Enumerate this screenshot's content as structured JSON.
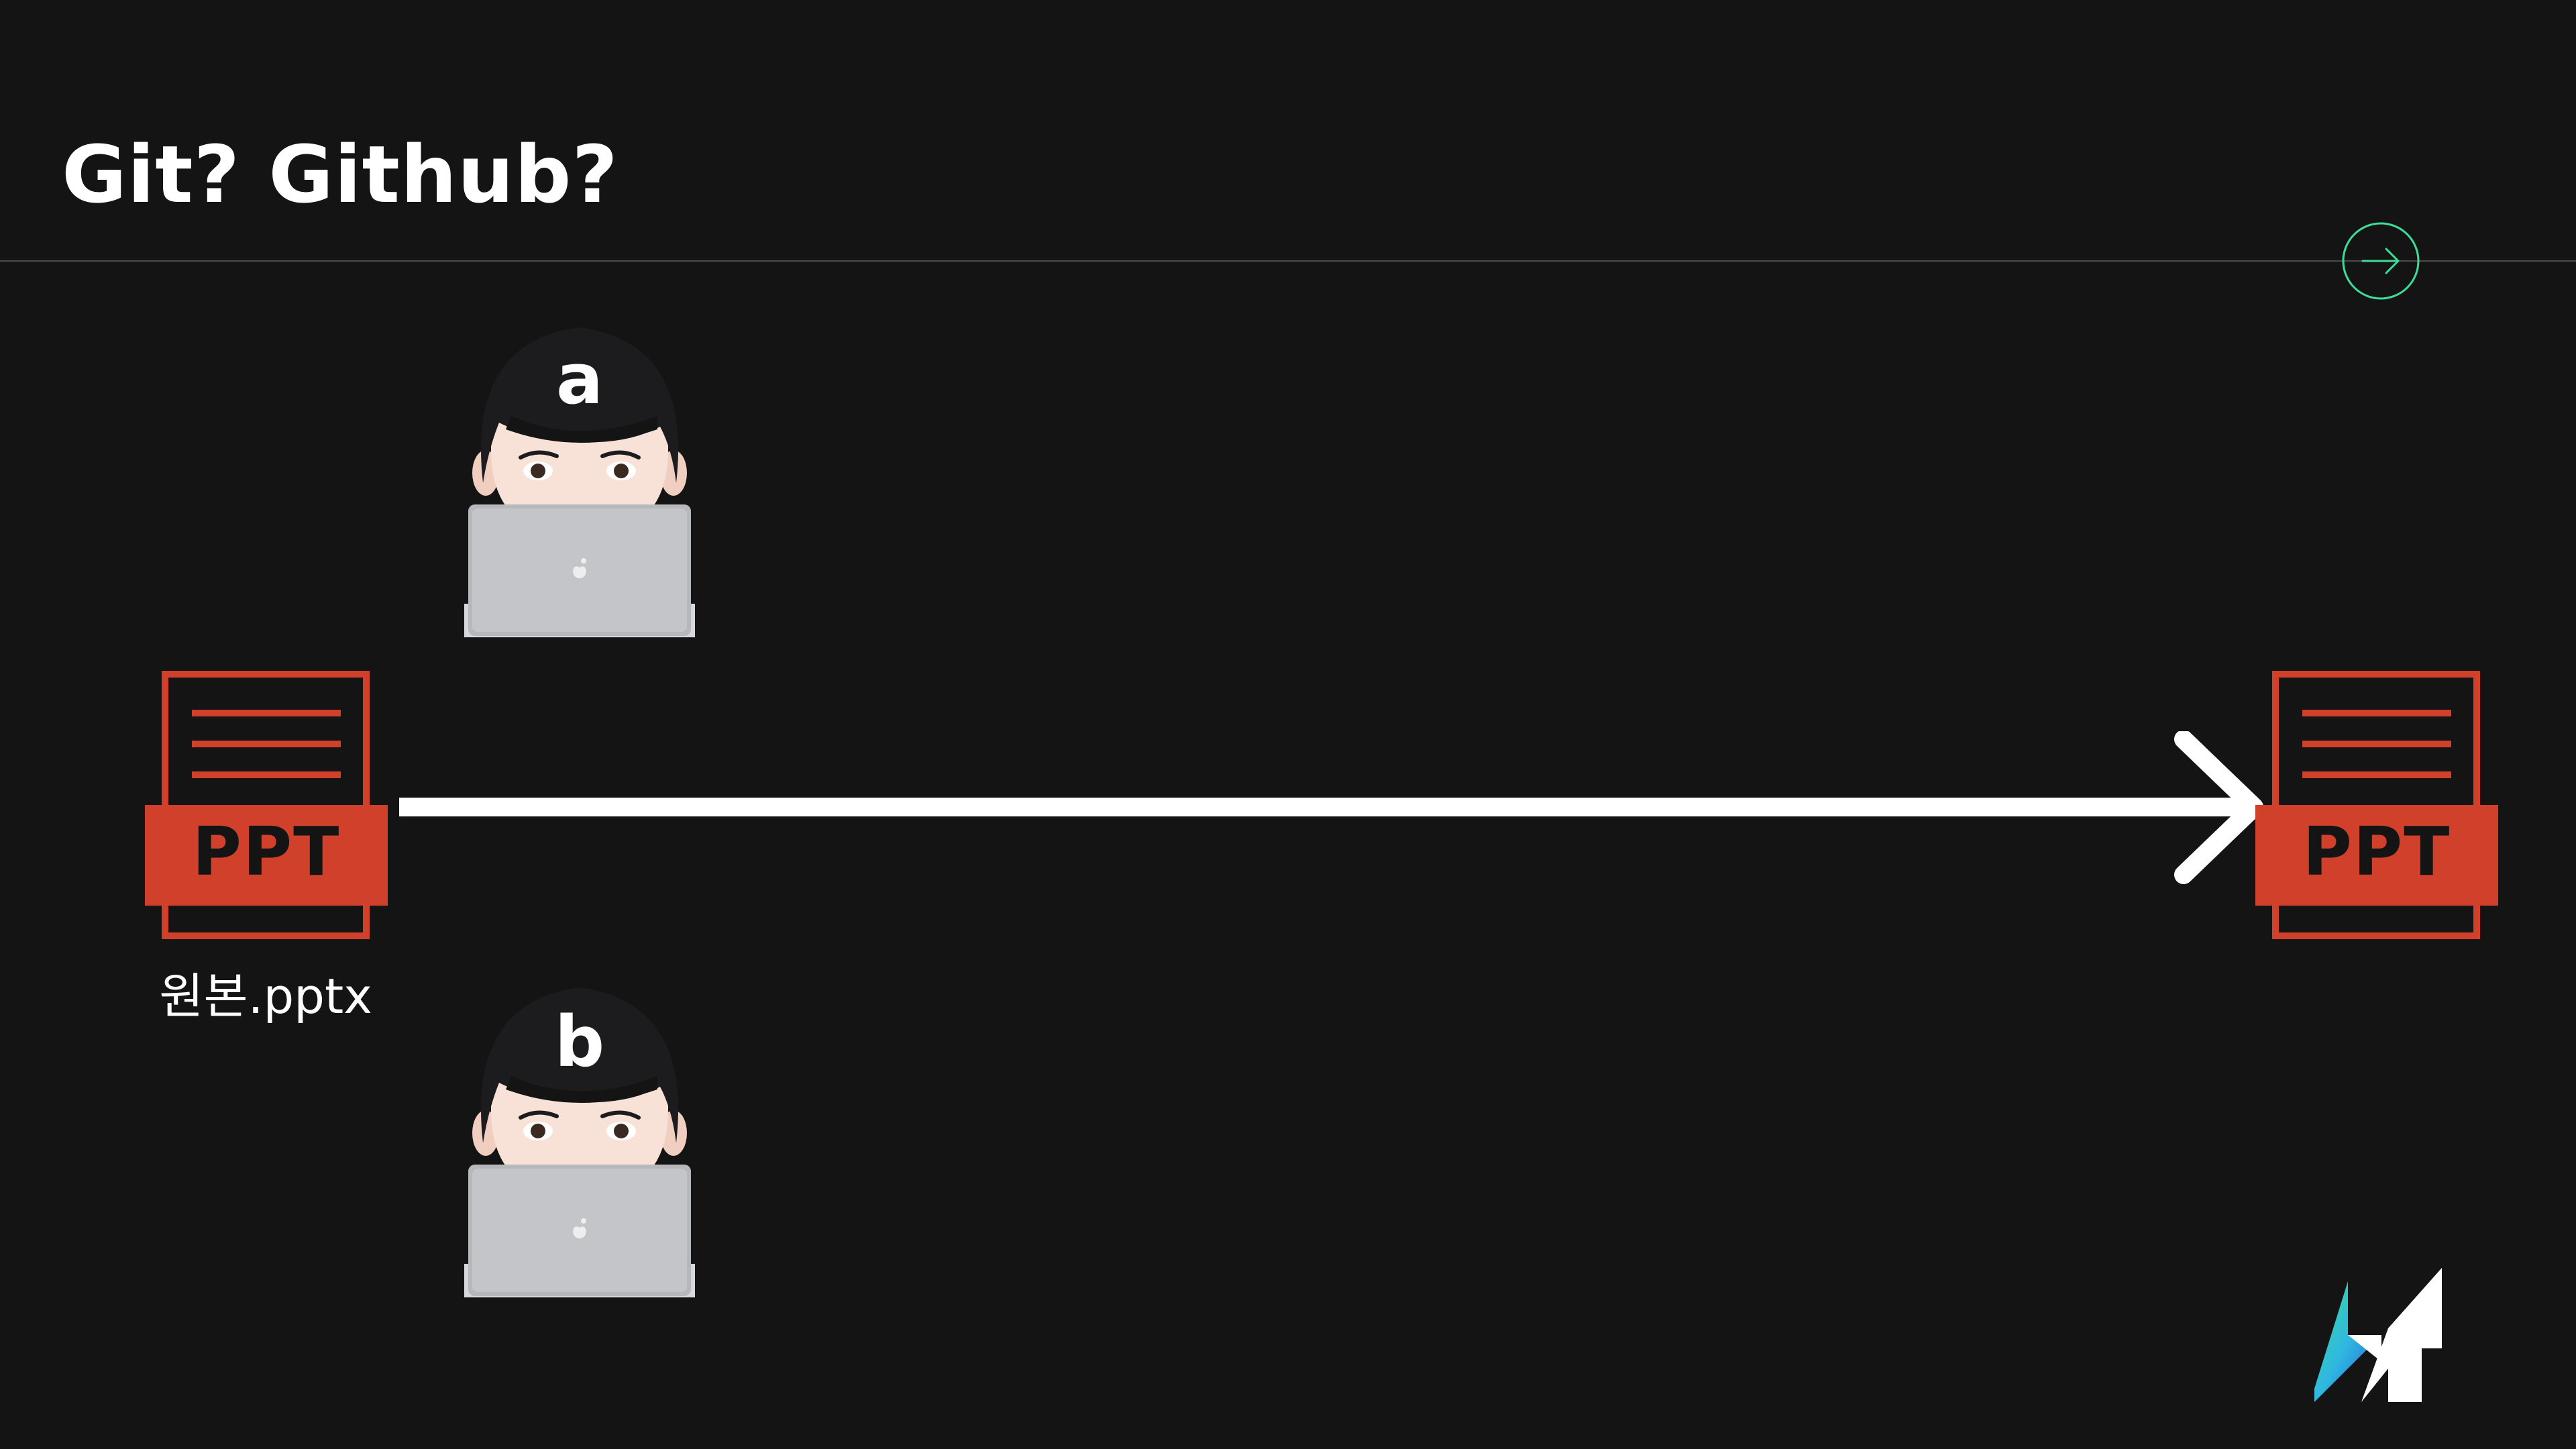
{
  "slide": {
    "title": "Git? Github?",
    "next_button_icon": "arrow-right-circle-icon",
    "accent_color": "#3ddc97",
    "background_color": "#141414"
  },
  "people": [
    {
      "label": "a",
      "icon": "developer-with-laptop-icon"
    },
    {
      "label": "b",
      "icon": "developer-with-laptop-icon"
    }
  ],
  "files": {
    "source": {
      "badge": "PPT",
      "name": "원본.pptx",
      "icon": "ppt-file-icon"
    },
    "result": {
      "badge": "PPT",
      "icon": "ppt-file-icon"
    },
    "file_color": "#d0402a"
  },
  "flow": {
    "icon": "long-arrow-right-icon",
    "color": "#ffffff"
  },
  "brand": {
    "icon": "brand-logo-icon"
  }
}
